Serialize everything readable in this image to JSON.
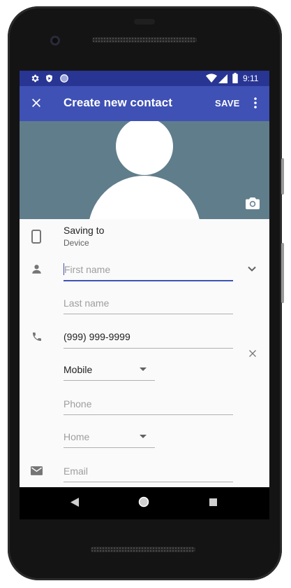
{
  "status_bar": {
    "time": "9:11",
    "left_icons": [
      "gear-icon",
      "shield-icon",
      "circle-icon"
    ],
    "right_icons": [
      "wifi-icon",
      "signal-icon",
      "battery-icon"
    ]
  },
  "toolbar": {
    "close_icon": "close-icon",
    "title": "Create new contact",
    "save_label": "SAVE",
    "overflow_icon": "more-vert-icon"
  },
  "photo": {
    "camera_icon": "camera-icon"
  },
  "saving": {
    "label": "Saving to",
    "account": "Device",
    "icon": "phone-device-icon"
  },
  "name": {
    "icon": "person-icon",
    "first_placeholder": "First name",
    "last_placeholder": "Last name",
    "expand_icon": "chevron-down-icon"
  },
  "phone": {
    "icon": "phone-icon",
    "value": "(999) 999-9999",
    "type_selected": "Mobile",
    "remove_icon": "close-icon",
    "new_placeholder": "Phone",
    "new_type_selected": "Home"
  },
  "email": {
    "icon": "mail-icon",
    "placeholder": "Email"
  },
  "nav": {
    "back_icon": "back-icon",
    "home_icon": "home-icon",
    "recents_icon": "recents-icon"
  },
  "colors": {
    "primary": "#3f51b5",
    "primary_dark": "#283593",
    "photo_bg": "#607d8b"
  }
}
